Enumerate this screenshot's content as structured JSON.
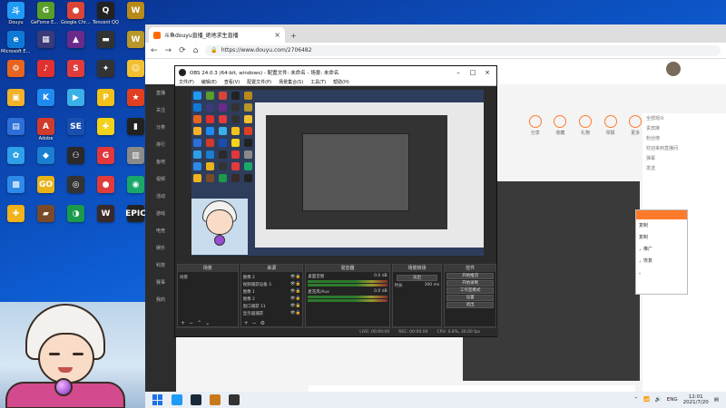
{
  "desktop": {
    "icons": [
      {
        "label": "Douyu",
        "glyph": "斗",
        "color": "#1f9bf5"
      },
      {
        "label": "GeForce Experience",
        "glyph": "G",
        "color": "#5a9e2a"
      },
      {
        "label": "Google Chrome",
        "glyph": "●",
        "color": "#db4437"
      },
      {
        "label": "Tencent QQ",
        "glyph": "Q",
        "color": "#222222"
      },
      {
        "label": "",
        "glyph": "W",
        "color": "#b88a1a"
      },
      {
        "label": "Microsoft Edge",
        "glyph": "e",
        "color": "#0f7ad6"
      },
      {
        "label": "",
        "glyph": "▦",
        "color": "#3a3a7a"
      },
      {
        "label": "",
        "glyph": "▲",
        "color": "#6a2a8a"
      },
      {
        "label": "",
        "glyph": "▬",
        "color": "#333333"
      },
      {
        "label": "",
        "glyph": "W",
        "color": "#b8972a"
      },
      {
        "label": "",
        "glyph": "⚙",
        "color": "#e8641e"
      },
      {
        "label": "",
        "glyph": "♪",
        "color": "#e03030"
      },
      {
        "label": "",
        "glyph": "S",
        "color": "#e23b3b"
      },
      {
        "label": "",
        "glyph": "✦",
        "color": "#333333"
      },
      {
        "label": "",
        "glyph": "☺",
        "color": "#f0c030"
      },
      {
        "label": "",
        "glyph": "▣",
        "color": "#f2b32a"
      },
      {
        "label": "",
        "glyph": "K",
        "color": "#1f8bf0"
      },
      {
        "label": "",
        "glyph": "▶",
        "color": "#3ab0e8"
      },
      {
        "label": "",
        "glyph": "P",
        "color": "#f2c21a"
      },
      {
        "label": "",
        "glyph": "★",
        "color": "#e04020"
      },
      {
        "label": "",
        "glyph": "▤",
        "color": "#2d6fd8"
      },
      {
        "label": "Adobe",
        "glyph": "A",
        "color": "#d13b2b"
      },
      {
        "label": "",
        "glyph": "SE",
        "color": "#1a4fb0"
      },
      {
        "label": "",
        "glyph": "✚",
        "color": "#f2d21a"
      },
      {
        "label": "",
        "glyph": "▮",
        "color": "#222222"
      },
      {
        "label": "",
        "glyph": "✿",
        "color": "#2da0e8"
      },
      {
        "label": "",
        "glyph": "◆",
        "color": "#1a7fd0"
      },
      {
        "label": "",
        "glyph": "⚇",
        "color": "#2a2a2a"
      },
      {
        "label": "",
        "glyph": "G",
        "color": "#e2373b"
      },
      {
        "label": "",
        "glyph": "▥",
        "color": "#8a8a8a"
      },
      {
        "label": "",
        "glyph": "▩",
        "color": "#2d8ae8"
      },
      {
        "label": "",
        "glyph": "GO",
        "color": "#e8b21a"
      },
      {
        "label": "",
        "glyph": "◎",
        "color": "#333333"
      },
      {
        "label": "",
        "glyph": "●",
        "color": "#e23b3b"
      },
      {
        "label": "",
        "glyph": "◉",
        "color": "#1aa86a"
      },
      {
        "label": "",
        "glyph": "✚",
        "color": "#f2b21a"
      },
      {
        "label": "",
        "glyph": "▰",
        "color": "#7a4a2a"
      },
      {
        "label": "",
        "glyph": "◑",
        "color": "#1a9a4a"
      },
      {
        "label": "",
        "glyph": "W",
        "color": "#3a2a2a"
      },
      {
        "label": "",
        "glyph": "EPIC",
        "color": "#222222"
      }
    ]
  },
  "browser": {
    "tab_title": "斗鱼douyu直播_绝地求生直播",
    "tab_close": "×",
    "new_tab": "+",
    "url": "https://www.douyu.com/2706482",
    "back": "←",
    "forward": "→",
    "reload": "⟳",
    "home": "⌂"
  },
  "page": {
    "left_nav": [
      "直播",
      "关注",
      "分类",
      "排行",
      "鱼吧",
      "视频",
      "活动",
      "游戏",
      "电竞",
      "娱乐",
      "科技",
      "赛事",
      "我的"
    ],
    "room_strip": [
      "分享",
      "收藏",
      "礼物",
      "举报",
      "更多"
    ],
    "right_panel": [
      "全部观众",
      "贵宾席",
      "粉丝榜",
      "欢迎来到直播间",
      "弹幕",
      "发送"
    ],
    "dialog_lines": [
      "复制",
      "复制",
      "，推广",
      "，恢复",
      "。"
    ]
  },
  "obs": {
    "title": "OBS 24.0.3 (64-bit, windows) - 配置文件: 未命名 - 场景: 未命名",
    "menu": [
      "文件(F)",
      "编辑(E)",
      "查看(V)",
      "配置文件(P)",
      "场景集合(S)",
      "工具(T)",
      "帮助(H)"
    ],
    "window_controls": [
      "–",
      "□",
      "×"
    ],
    "docks": {
      "scenes": {
        "title": "场景",
        "items": [
          "场景"
        ]
      },
      "sources": {
        "title": "来源",
        "items": [
          "图像 2",
          "视频捕获设备 3",
          "图像 1",
          "图像 2",
          "窗口捕获 11",
          "显示器捕获"
        ]
      },
      "mixer": {
        "title": "混音器",
        "rows": [
          {
            "name": "桌面音频",
            "db": "0.0 dB"
          },
          {
            "name": "麦克风/Aux",
            "db": "0.0 dB"
          }
        ]
      },
      "transitions": {
        "title": "场景转场",
        "mode": "淡出",
        "duration_label": "时长",
        "duration": "300 ms"
      },
      "controls": {
        "title": "控件",
        "buttons": [
          "开始推流",
          "开始录制",
          "工作室模式",
          "设置",
          "退出"
        ]
      }
    },
    "status": [
      "LIVE: 00:00:00",
      "REC: 00:00:00",
      "CPU: 0.8%, 30.00 fps"
    ]
  },
  "taskbar": {
    "lang": "ENG",
    "time": "12:01",
    "date": "2021/7/20"
  }
}
